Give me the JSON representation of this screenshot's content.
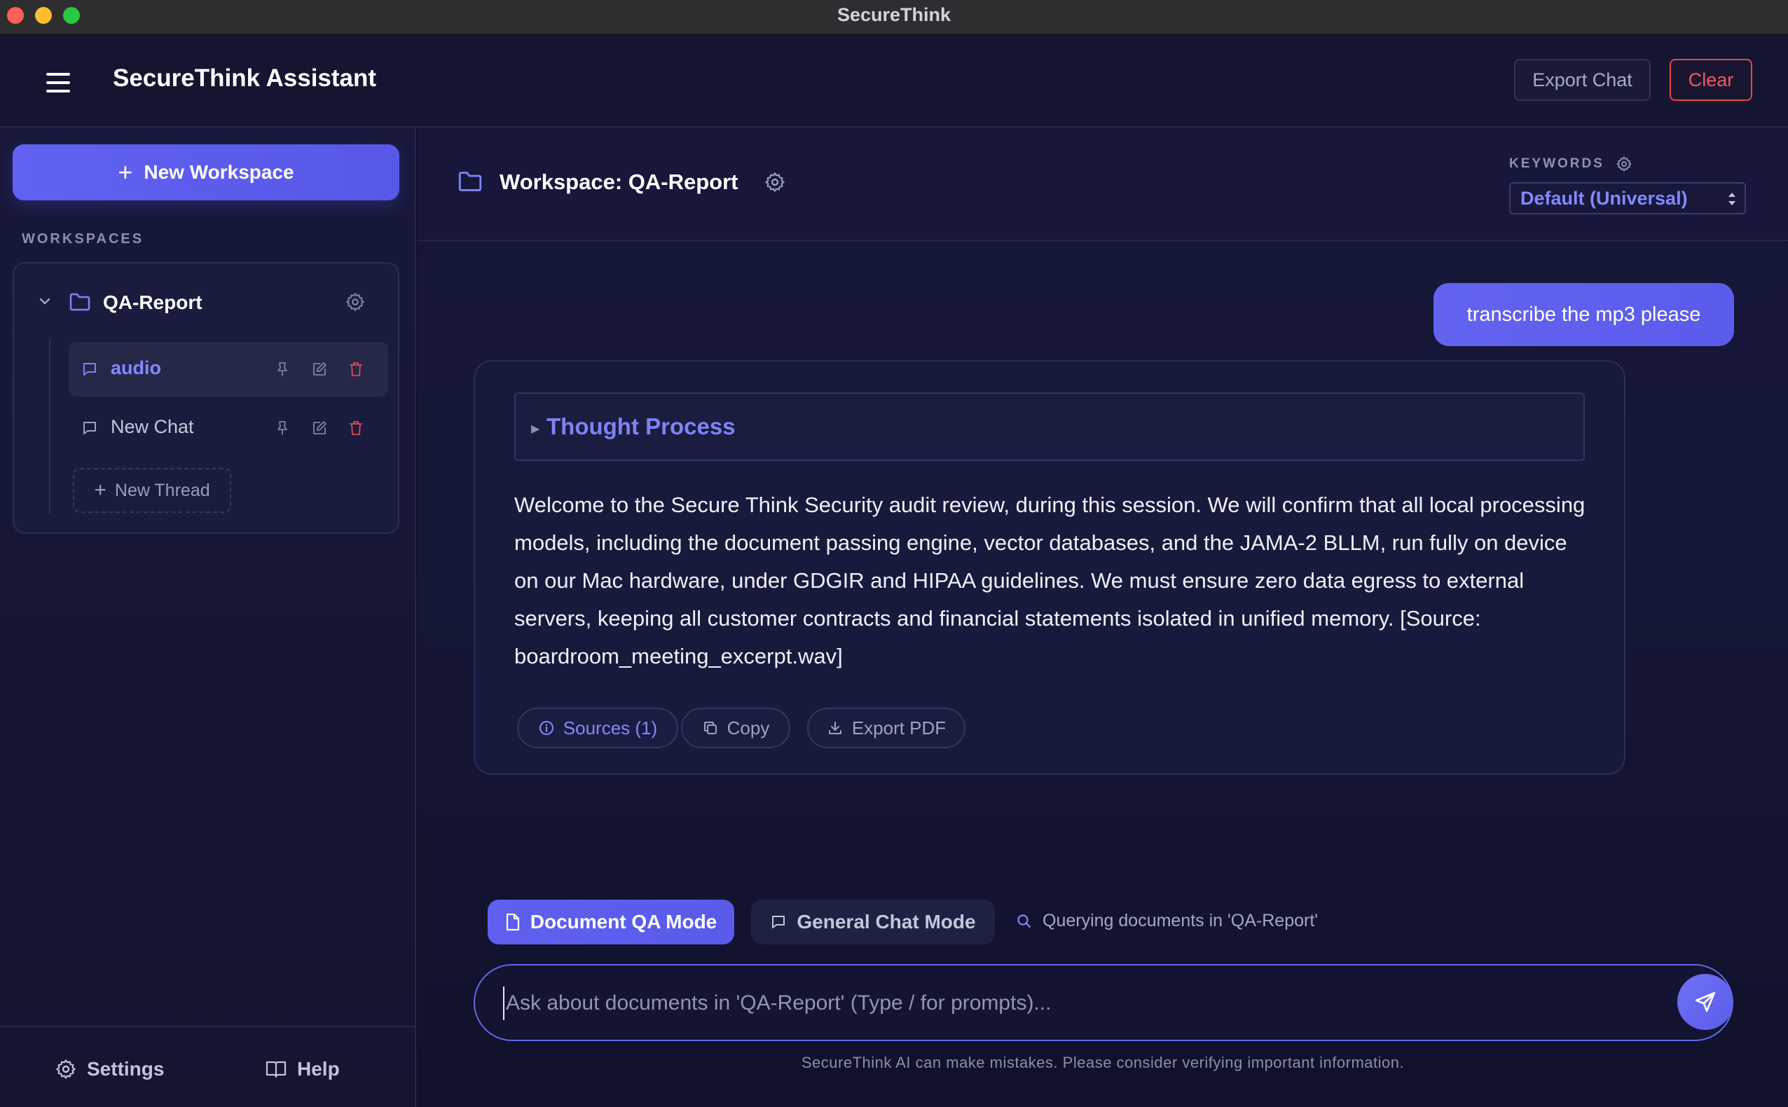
{
  "window": {
    "title": "SecureThink"
  },
  "header": {
    "app_title": "SecureThink Assistant",
    "export_chat_label": "Export Chat",
    "clear_label": "Clear"
  },
  "sidebar": {
    "new_workspace_label": "New Workspace",
    "workspaces_heading": "WORKSPACES",
    "workspace": {
      "name": "QA-Report",
      "expanded": true,
      "threads": [
        {
          "label": "audio",
          "active": true
        },
        {
          "label": "New Chat",
          "active": false
        }
      ],
      "new_thread_label": "New Thread"
    },
    "footer": {
      "settings_label": "Settings",
      "help_label": "Help"
    }
  },
  "main": {
    "workspace_title": "Workspace: QA-Report",
    "keywords_label": "KEYWORDS",
    "keywords_selected": "Default (Universal)",
    "messages": {
      "user": "transcribe the mp3 please",
      "assistant": {
        "thought_label": "Thought Process",
        "text": "Welcome to the Secure Think Security audit review, during this session. We will confirm that all local processing models, including the document passing engine, vector databases, and the JAMA-2 BLLM, run fully on device on our Mac hardware, under GDGIR and HIPAA guidelines. We must ensure zero data egress to external servers, keeping all customer contracts and financial statements isolated in unified memory. [Source: boardroom_meeting_excerpt.wav]",
        "sources_label": "Sources (1)",
        "copy_label": "Copy",
        "export_pdf_label": "Export PDF"
      }
    },
    "modes": {
      "document_qa_label": "Document QA Mode",
      "general_chat_label": "General Chat Mode",
      "active": "Document QA Mode",
      "query_status": "Querying documents in 'QA-Report'"
    },
    "input": {
      "placeholder": "Ask about documents in 'QA-Report' (Type / for prompts)...",
      "value": ""
    },
    "disclaimer": "SecureThink AI can make mistakes. Please consider verifying important information."
  },
  "colors": {
    "accent": "#6161f2",
    "danger": "#e5484d",
    "background": "#121229",
    "link": "#8588ff"
  },
  "icons": {
    "menu": "hamburger-icon",
    "workspace": "folder-icon",
    "settings": "gear-icon",
    "thread": "chat-bubble-icon",
    "pin": "pin-icon",
    "edit": "edit-icon",
    "delete": "trash-icon",
    "help": "book-icon",
    "sources": "info-icon",
    "copy": "copy-icon",
    "export": "download-icon",
    "document": "document-icon",
    "search": "search-icon",
    "send": "send-icon"
  }
}
